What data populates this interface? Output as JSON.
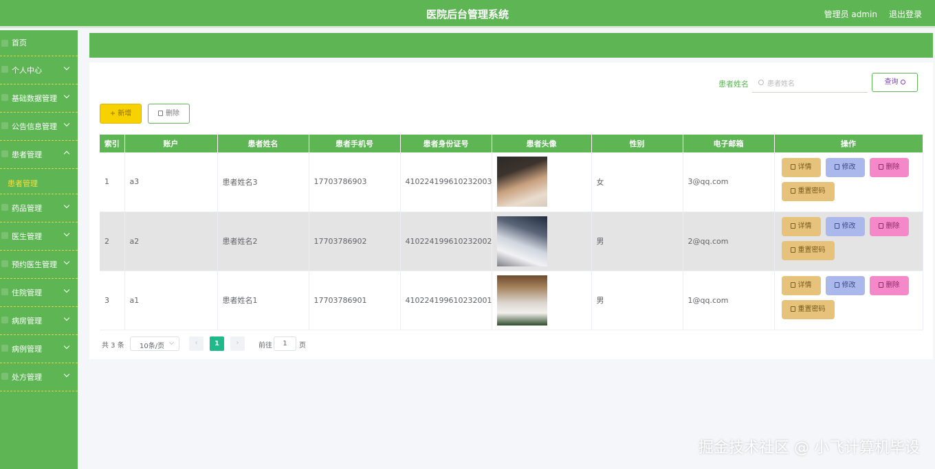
{
  "header": {
    "title": "医院后台管理系统",
    "admin": "管理员 admin",
    "logout": "退出登录"
  },
  "sidebar": {
    "items": [
      {
        "label": "首页"
      },
      {
        "label": "个人中心"
      },
      {
        "label": "基础数据管理"
      },
      {
        "label": "公告信息管理"
      },
      {
        "label": "患者管理"
      },
      {
        "label": "患者管理"
      },
      {
        "label": "药品管理"
      },
      {
        "label": "医生管理"
      },
      {
        "label": "预约医生管理"
      },
      {
        "label": "住院管理"
      },
      {
        "label": "病房管理"
      },
      {
        "label": "病例管理"
      },
      {
        "label": "处方管理"
      }
    ]
  },
  "search": {
    "label": "患者姓名",
    "placeholder": "患者姓名",
    "button": "查询"
  },
  "actions": {
    "add": "+ 新增",
    "delete": "删除"
  },
  "table": {
    "headers": [
      "索引",
      "账户",
      "患者姓名",
      "患者手机号",
      "患者身份证号",
      "患者头像",
      "性别",
      "电子邮箱",
      "操作"
    ],
    "rows": [
      {
        "index": "1",
        "account": "a3",
        "name": "患者姓名3",
        "phone": "17703786903",
        "idcard": "410224199610232003",
        "gender": "女",
        "email": "3@qq.com"
      },
      {
        "index": "2",
        "account": "a2",
        "name": "患者姓名2",
        "phone": "17703786902",
        "idcard": "410224199610232002",
        "gender": "男",
        "email": "2@qq.com"
      },
      {
        "index": "3",
        "account": "a1",
        "name": "患者姓名1",
        "phone": "17703786901",
        "idcard": "410224199610232001",
        "gender": "男",
        "email": "1@qq.com"
      }
    ],
    "ops": {
      "detail": "详情",
      "edit": "修改",
      "delete": "删除",
      "reset": "重置密码"
    }
  },
  "pagination": {
    "total": "共 3 条",
    "page_size": "10条/页",
    "prev": "‹",
    "current": "1",
    "next": "›",
    "goto": "前往",
    "goto_value": "1",
    "page_unit": "页"
  },
  "watermark": "掘金技术社区 @ 小飞计算机毕设"
}
